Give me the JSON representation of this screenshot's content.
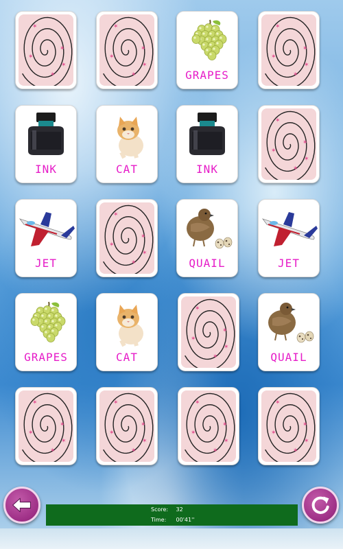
{
  "cards": [
    {
      "id": "r1c1",
      "state": "down"
    },
    {
      "id": "r1c2",
      "state": "down"
    },
    {
      "id": "r1c3",
      "state": "up",
      "label": "GRAPES",
      "icon": "grapes-icon"
    },
    {
      "id": "r1c4",
      "state": "down"
    },
    {
      "id": "r2c1",
      "state": "up",
      "label": "INK",
      "icon": "ink-bottle-icon"
    },
    {
      "id": "r2c2",
      "state": "up",
      "label": "CAT",
      "icon": "kitten-icon"
    },
    {
      "id": "r2c3",
      "state": "up",
      "label": "INK",
      "icon": "ink-bottle-icon"
    },
    {
      "id": "r2c4",
      "state": "down"
    },
    {
      "id": "r3c1",
      "state": "up",
      "label": "JET",
      "icon": "jet-icon"
    },
    {
      "id": "r3c2",
      "state": "down"
    },
    {
      "id": "r3c3",
      "state": "up",
      "label": "QUAIL",
      "icon": "quail-icon"
    },
    {
      "id": "r3c4",
      "state": "up",
      "label": "JET",
      "icon": "jet-icon"
    },
    {
      "id": "r4c1",
      "state": "up",
      "label": "GRAPES",
      "icon": "grapes-icon"
    },
    {
      "id": "r4c2",
      "state": "up",
      "label": "CAT",
      "icon": "kitten-icon"
    },
    {
      "id": "r4c3",
      "state": "down"
    },
    {
      "id": "r4c4",
      "state": "up",
      "label": "QUAIL",
      "icon": "quail-icon"
    },
    {
      "id": "r5c1",
      "state": "down"
    },
    {
      "id": "r5c2",
      "state": "down"
    },
    {
      "id": "r5c3",
      "state": "down"
    },
    {
      "id": "r5c4",
      "state": "down"
    }
  ],
  "status": {
    "score_label": "Score:",
    "score_value": "32",
    "time_label": "Time:",
    "time_value": "00'41''"
  },
  "controls": {
    "back_icon": "back-arrow-icon",
    "restart_icon": "restart-icon"
  },
  "colors": {
    "card_back": "#f4d6d8",
    "label": "#e61cc8",
    "status_bar": "#0f6b1d",
    "button": "#9e2f86"
  }
}
